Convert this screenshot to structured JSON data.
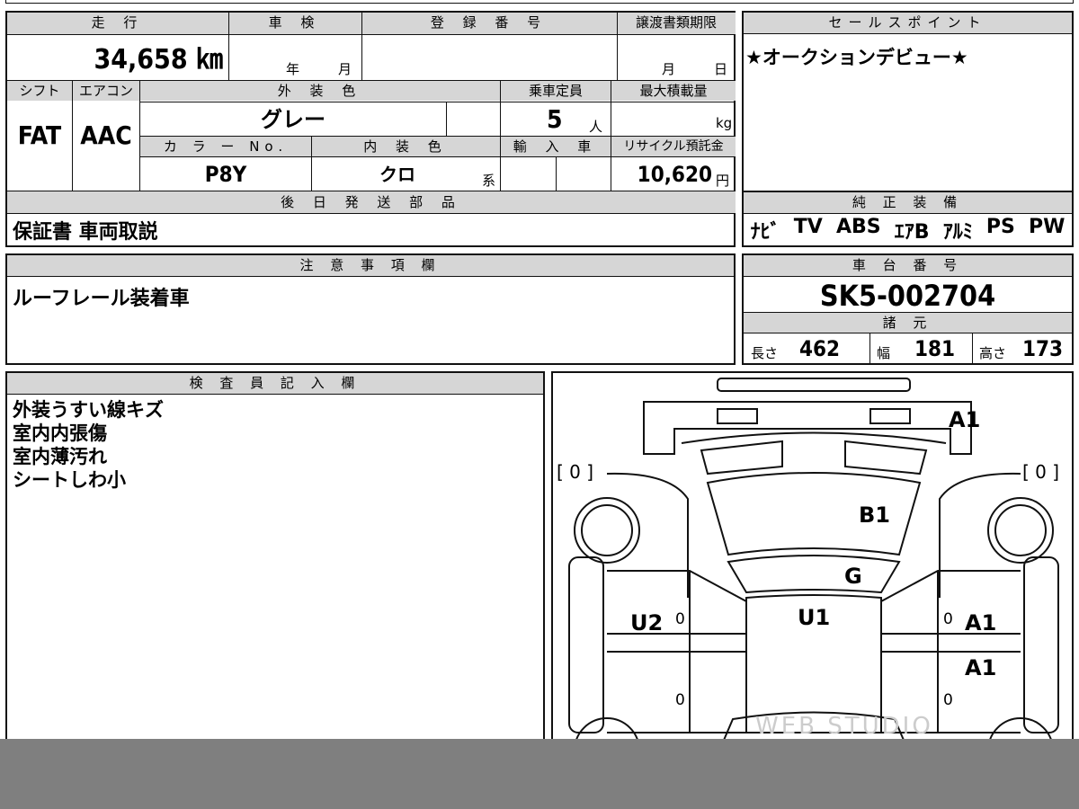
{
  "top": {
    "mileage_label": "走 行",
    "mileage_value": "34,658 ㎞",
    "inspection_label": "車 検",
    "inspection_year": "年",
    "inspection_month": "月",
    "reg_label": "登 録 番 号",
    "transfer_label": "譲渡書類期限",
    "transfer_month": "月",
    "transfer_day": "日",
    "shift_label": "シフト",
    "ac_label": "エアコン",
    "shift_value": "FAT",
    "ac_value": "AAC",
    "ext_color_label": "外 装 色",
    "ext_color_value": "グレー",
    "capacity_label": "乗車定員",
    "capacity_value": "5",
    "capacity_unit": "人",
    "max_load_label": "最大積載量",
    "max_load_unit": "kg",
    "color_no_label": "カ ラ ー No.",
    "color_no_value": "P8Y",
    "int_color_label": "内 装 色",
    "int_color_value": "クロ",
    "int_color_suffix": "系",
    "import_label": "輸 入 車",
    "recycle_label": "リサイクル預託金",
    "recycle_value": "10,620",
    "recycle_unit": "円",
    "later_parts_label": "後 日 発 送 部 品",
    "later_parts_value": "保証書 車両取説"
  },
  "sales": {
    "label": "セールスポイント",
    "value": "★オークションデビュー★"
  },
  "equipment": {
    "label": "純 正 装 備",
    "items": [
      "ﾅﾋﾞ",
      "TV",
      "ABS",
      "ｴｱB",
      "ｱﾙﾐ",
      "PS",
      "PW"
    ]
  },
  "notes": {
    "label": "注 意 事 項 欄",
    "value": "ルーフレール装着車"
  },
  "chassis": {
    "label": "車 台 番 号",
    "value": "SK5-002704",
    "spec_label": "諸 元",
    "length_label": "長さ",
    "length_value": "462",
    "width_label": "幅",
    "width_value": "181",
    "height_label": "高さ",
    "height_value": "173"
  },
  "inspector": {
    "label": "検 査 員 記 入 欄",
    "lines": [
      "外装うすい線キズ",
      "室内内張傷",
      "室内薄汚れ",
      "シートしわ小"
    ]
  },
  "diagram": {
    "marks": {
      "rear_right": "A1",
      "back_glass": "B1",
      "roof_glass": "G",
      "roof": "U1",
      "left_door": "U2",
      "right_front_door": "A1",
      "right_rear_door": "A1"
    },
    "tire_left": "[ 0 ]",
    "tire_right": "[ 0 ]",
    "zero": "0",
    "watermark": "WEB STUDIO"
  }
}
